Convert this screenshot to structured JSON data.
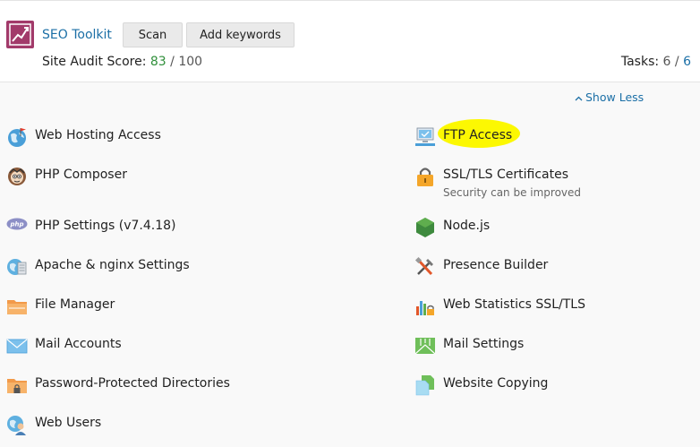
{
  "seo": {
    "name": "SEO Toolkit",
    "scan_label": "Scan",
    "keywords_label": "Add keywords"
  },
  "audit": {
    "label": "Site Audit Score:",
    "score": "83",
    "total": "/ 100"
  },
  "tasks": {
    "label": "Tasks:",
    "done": "6 /",
    "count": "6"
  },
  "toggle_label": "Show Less",
  "left_items": [
    {
      "label": "Web Hosting Access"
    },
    {
      "label": "PHP Composer"
    },
    {
      "label": "PHP Settings (v7.4.18)"
    },
    {
      "label": "Apache & nginx Settings"
    },
    {
      "label": "File Manager"
    },
    {
      "label": "Mail Accounts"
    },
    {
      "label": "Password-Protected Directories"
    },
    {
      "label": "Web Users"
    }
  ],
  "right_items": [
    {
      "label": "FTP Access"
    },
    {
      "label": "SSL/TLS Certificates",
      "sub": "Security can be improved"
    },
    {
      "label": "Node.js"
    },
    {
      "label": "Presence Builder"
    },
    {
      "label": "Web Statistics SSL/TLS"
    },
    {
      "label": "Mail Settings"
    },
    {
      "label": "Website Copying"
    }
  ],
  "colors": {
    "highlight": "#fcf802",
    "link": "#1b6fa6",
    "score": "#2f8f3a"
  }
}
